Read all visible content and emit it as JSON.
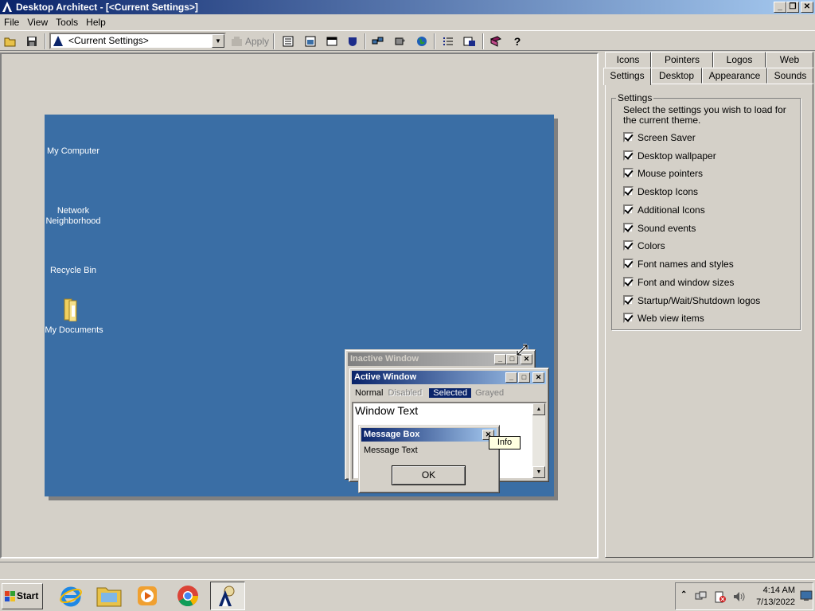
{
  "window": {
    "title": "Desktop Architect - [<Current Settings>]"
  },
  "menu": [
    "File",
    "View",
    "Tools",
    "Help"
  ],
  "toolbar": {
    "combo_value": "<Current Settings>",
    "apply_label": "Apply"
  },
  "preview": {
    "desktop_icons": [
      "My Computer",
      "Network Neighborhood",
      "Recycle Bin",
      "My Documents"
    ],
    "inactive_window_title": "Inactive Window",
    "active_window_title": "Active Window",
    "menu_states": [
      "Normal",
      "Disabled",
      "Selected",
      "Grayed"
    ],
    "window_text": "Window Text",
    "message_box_title": "Message Box",
    "message_text": "Message Text",
    "ok_label": "OK",
    "tooltip": "Info"
  },
  "tabs_row1": [
    "Icons",
    "Pointers",
    "Logos",
    "Web"
  ],
  "tabs_row2": [
    "Settings",
    "Desktop",
    "Appearance",
    "Sounds"
  ],
  "settings": {
    "group_label": "Settings",
    "description": "Select the settings you wish to load for the current theme.",
    "items": [
      {
        "label": "Screen Saver",
        "checked": true
      },
      {
        "label": "Desktop wallpaper",
        "checked": true
      },
      {
        "label": "Mouse pointers",
        "checked": true
      },
      {
        "label": "Desktop Icons",
        "checked": true
      },
      {
        "label": "Additional Icons",
        "checked": true
      },
      {
        "label": "Sound events",
        "checked": true
      },
      {
        "label": "Colors",
        "checked": true
      },
      {
        "label": "Font names and styles",
        "checked": true
      },
      {
        "label": "Font and window sizes",
        "checked": true
      },
      {
        "label": "Startup/Wait/Shutdown logos",
        "checked": true
      },
      {
        "label": "Web view items",
        "checked": true
      }
    ]
  },
  "taskbar": {
    "start_label": "Start",
    "time": "4:14 AM",
    "date": "7/13/2022"
  },
  "colors": {
    "desktop": "#3a6ea5",
    "title_active": "#0a246a",
    "title_inactive": "#808080"
  }
}
